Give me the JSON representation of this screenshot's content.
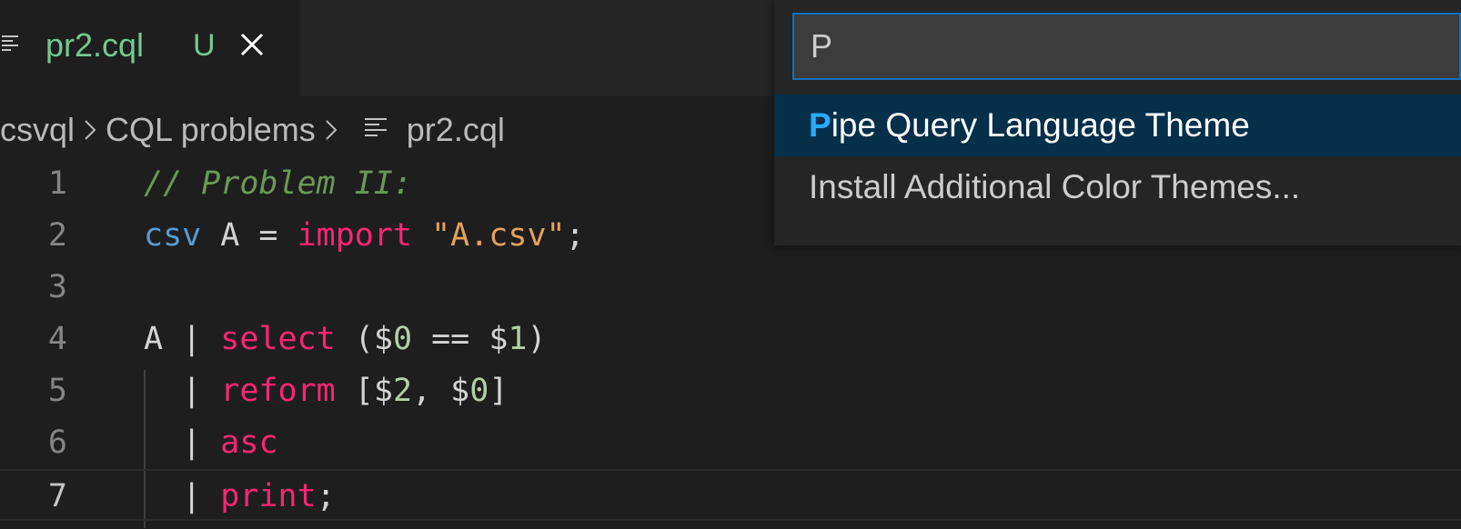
{
  "tab": {
    "file_name": "pr2.cql",
    "status": "U",
    "icon": "lines-file-icon",
    "close_icon": "close-icon"
  },
  "breadcrumb": {
    "items": [
      "csvql",
      "CQL problems",
      "pr2.cql"
    ]
  },
  "editor": {
    "lines": [
      {
        "num": "1",
        "tokens": [
          {
            "t": "// Problem II:",
            "k": "c-comment"
          }
        ]
      },
      {
        "num": "2",
        "tokens": [
          {
            "t": "csv",
            "k": "c-type"
          },
          {
            "t": " A = ",
            "k": "c-plain"
          },
          {
            "t": "import",
            "k": "c-kw"
          },
          {
            "t": " ",
            "k": "c-plain"
          },
          {
            "t": "\"A.csv\"",
            "k": "c-str"
          },
          {
            "t": ";",
            "k": "c-plain"
          }
        ]
      },
      {
        "num": "3",
        "tokens": []
      },
      {
        "num": "4",
        "tokens": [
          {
            "t": "A | ",
            "k": "c-plain"
          },
          {
            "t": "select",
            "k": "c-kw"
          },
          {
            "t": " ($",
            "k": "c-plain"
          },
          {
            "t": "0",
            "k": "c-num"
          },
          {
            "t": " == $",
            "k": "c-plain"
          },
          {
            "t": "1",
            "k": "c-num"
          },
          {
            "t": ")",
            "k": "c-plain"
          }
        ]
      },
      {
        "num": "5",
        "tokens": [
          {
            "t": "  | ",
            "k": "c-plain"
          },
          {
            "t": "reform",
            "k": "c-kw"
          },
          {
            "t": " [$",
            "k": "c-plain"
          },
          {
            "t": "2",
            "k": "c-num"
          },
          {
            "t": ", $",
            "k": "c-plain"
          },
          {
            "t": "0",
            "k": "c-num"
          },
          {
            "t": "]",
            "k": "c-plain"
          }
        ]
      },
      {
        "num": "6",
        "tokens": [
          {
            "t": "  | ",
            "k": "c-plain"
          },
          {
            "t": "asc",
            "k": "c-kw"
          }
        ]
      },
      {
        "num": "7",
        "tokens": [
          {
            "t": "  | ",
            "k": "c-plain"
          },
          {
            "t": "print",
            "k": "c-kw"
          },
          {
            "t": ";",
            "k": "c-plain"
          }
        ]
      }
    ],
    "active_line": "7"
  },
  "quick_pick": {
    "input_value": "P",
    "items": [
      {
        "match": "P",
        "rest": "ipe Query Language Theme",
        "selected": true
      },
      {
        "match": "",
        "rest": "Install Additional Color Themes...",
        "selected": false
      }
    ]
  },
  "colors": {
    "accent": "#0e70c0",
    "match_highlight": "#2aaaff",
    "untracked_green": "#73c991",
    "selection_bg": "#062f4a"
  }
}
